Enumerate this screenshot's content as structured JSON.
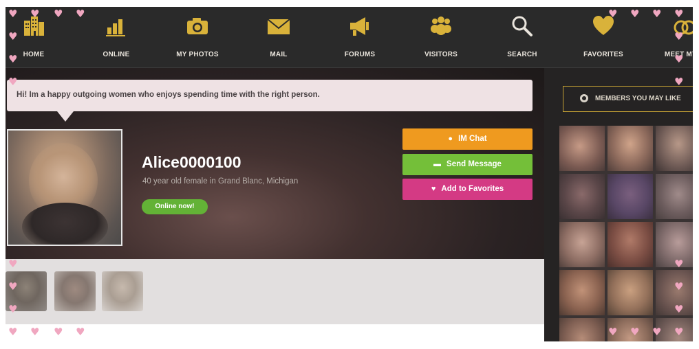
{
  "nav": {
    "items": [
      {
        "label": "HOME",
        "icon": "building-icon"
      },
      {
        "label": "ONLINE",
        "icon": "bar-chart-icon"
      },
      {
        "label": "MY PHOTOS",
        "icon": "camera-icon"
      },
      {
        "label": "MAIL",
        "icon": "envelope-icon"
      },
      {
        "label": "FORUMS",
        "icon": "megaphone-icon"
      },
      {
        "label": "VISITORS",
        "icon": "people-icon"
      },
      {
        "label": "SEARCH",
        "icon": "magnifier-icon"
      },
      {
        "label": "FAVORITES",
        "icon": "heart-icon"
      },
      {
        "label": "MEET MY M",
        "icon": "rings-icon"
      }
    ]
  },
  "profile": {
    "bio": "Hi! Im a happy outgoing women who enjoys spending time with the right person.",
    "name": "Alice0000100",
    "subtitle": "40 year old female in Grand Blanc, Michigan",
    "online_badge": "Online now!"
  },
  "actions": {
    "chat_label": "IM Chat",
    "message_label": "Send Message",
    "favorite_label": "Add to Favorites"
  },
  "sidebar": {
    "members_label": "MEMBERS YOU MAY LIKE"
  },
  "colors": {
    "accent_gold": "#d9b23a",
    "chat_orange": "#ef9a1f",
    "message_green": "#74bf39",
    "favorite_pink": "#d43a84",
    "online_green": "#63b236",
    "heart_pink": "#f0a7c0"
  }
}
